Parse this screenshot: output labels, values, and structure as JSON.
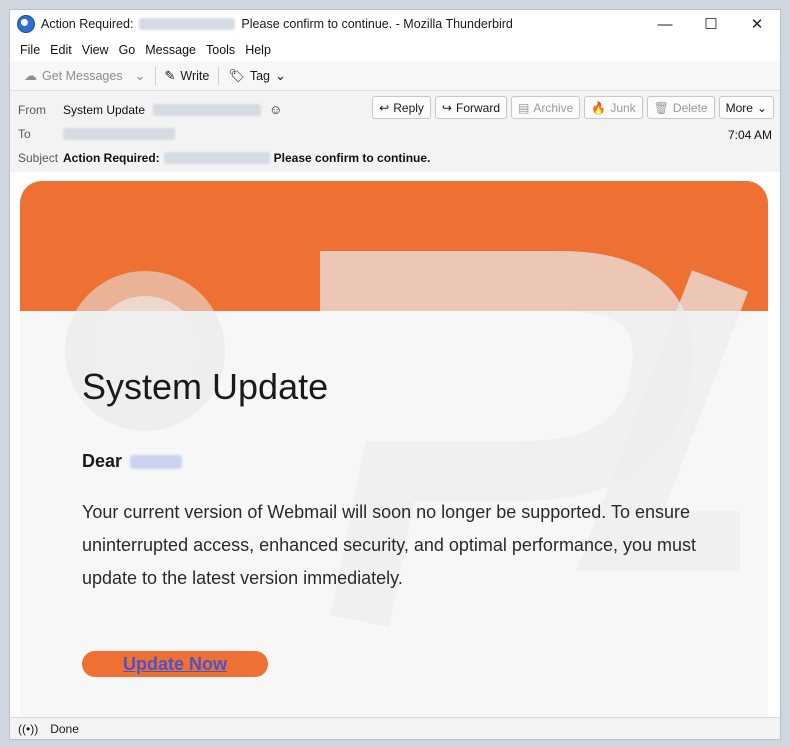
{
  "window": {
    "title_prefix": "Action Required:",
    "title_suffix": "Please confirm to continue. - Mozilla Thunderbird",
    "minimize": "—",
    "maximize": "☐",
    "close": "✕"
  },
  "menu": [
    "File",
    "Edit",
    "View",
    "Go",
    "Message",
    "Tools",
    "Help"
  ],
  "toolbar": {
    "get_messages": "Get Messages",
    "write": "Write",
    "tag": "Tag"
  },
  "header": {
    "from_label": "From",
    "from_value": "System Update",
    "to_label": "To",
    "subject_label": "Subject",
    "subject_prefix": "Action Required:",
    "subject_suffix": "Please confirm to continue.",
    "time": "7:04 AM",
    "actions": {
      "reply": "Reply",
      "forward": "Forward",
      "archive": "Archive",
      "junk": "Junk",
      "delete": "Delete",
      "more": "More"
    }
  },
  "email": {
    "heading": "System Update",
    "dear": "Dear",
    "body": "Your current version of Webmail will soon no longer be supported. To ensure uninterrupted access, enhanced security, and optimal performance, you must update to the latest version immediately.",
    "cta": "Update Now",
    "brand_color": "#ee7133"
  },
  "status": {
    "text": "Done"
  }
}
